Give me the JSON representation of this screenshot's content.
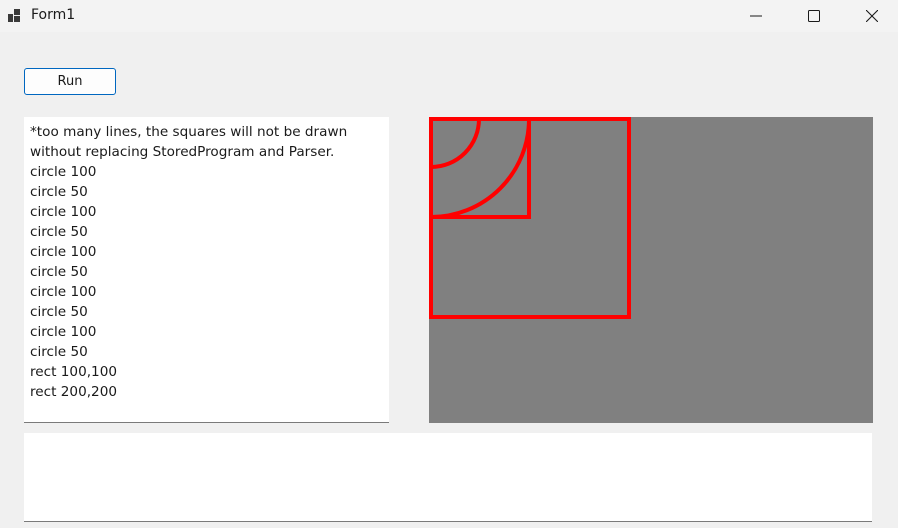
{
  "window": {
    "title": "Form1",
    "icons": {
      "app": "app-icon",
      "minimize": "minimize-icon",
      "maximize": "maximize-icon",
      "close": "close-icon"
    }
  },
  "toolbar": {
    "run_label": "Run"
  },
  "editor": {
    "lines": [
      "*too many lines, the squares will not be drawn",
      "without replacing StoredProgram and Parser.",
      "circle 100",
      "circle 50",
      "circle 100",
      "circle 50",
      "circle 100",
      "circle 50",
      "circle 100",
      "circle 50",
      "circle 100",
      "circle 50",
      "rect 100,100",
      "rect 200,200"
    ]
  },
  "canvas": {
    "background_color": "#808080",
    "pen_color": "#ff0000",
    "shapes": [
      {
        "type": "circle",
        "radius": 100
      },
      {
        "type": "circle",
        "radius": 50
      },
      {
        "type": "rect",
        "width": 100,
        "height": 100
      },
      {
        "type": "rect",
        "width": 200,
        "height": 200
      }
    ]
  },
  "output": {
    "text": ""
  }
}
